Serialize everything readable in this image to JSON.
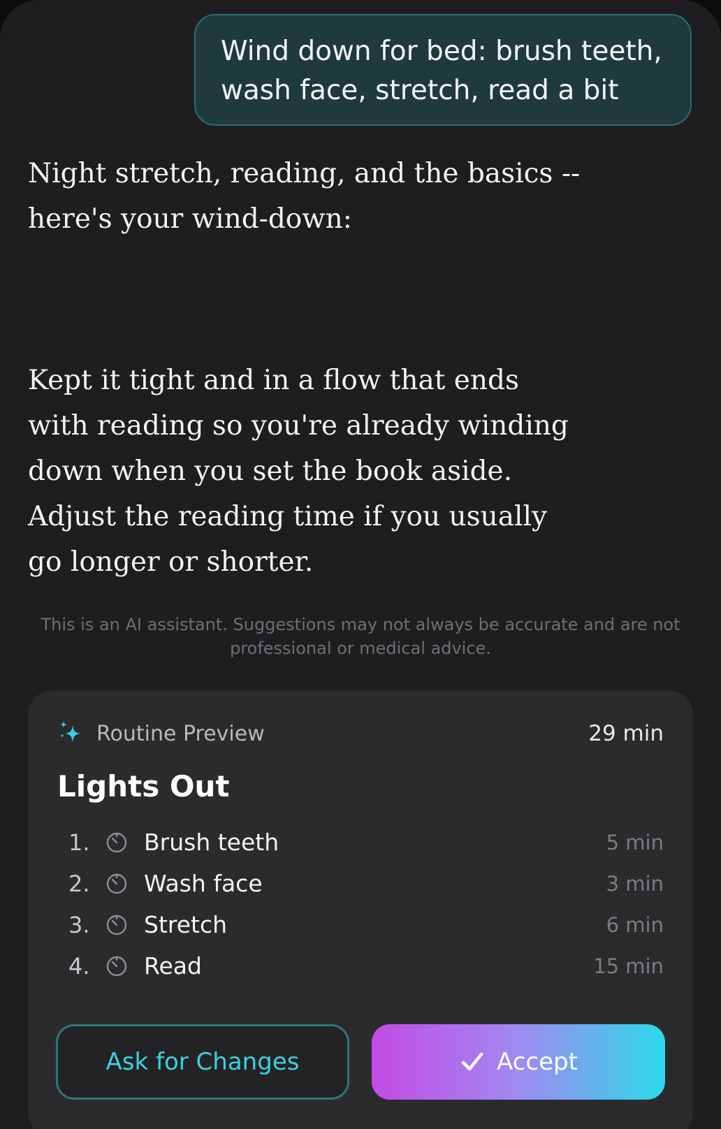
{
  "user_message": {
    "text": "Wind down for bed: brush teeth, wash face, stretch, read a bit"
  },
  "assistant": {
    "intro": "Night stretch, reading, and the basics -- here's your wind-down:",
    "outro": "Kept it tight and in a flow that ends with reading so you're already winding down when you set the book aside. Adjust the reading time if you usually go longer or shorter."
  },
  "disclaimer": "This is an AI assistant. Suggestions may not always be accurate and are not professional or medical advice.",
  "routine_preview": {
    "header_label": "Routine Preview",
    "header_icon": "sparkle-icon",
    "total_duration": "29 min",
    "title": "Lights Out",
    "steps": [
      {
        "number": "1.",
        "icon": "timer-icon",
        "name": "Brush teeth",
        "duration": "5 min"
      },
      {
        "number": "2.",
        "icon": "timer-icon",
        "name": "Wash face",
        "duration": "3 min"
      },
      {
        "number": "3.",
        "icon": "timer-icon",
        "name": "Stretch",
        "duration": "6 min"
      },
      {
        "number": "4.",
        "icon": "timer-icon",
        "name": "Read",
        "duration": "15 min"
      }
    ],
    "ask_changes_label": "Ask for Changes",
    "accept_label": "Accept"
  },
  "colors": {
    "accent_teal": "#3fd0e0",
    "accept_gradient_start": "#c34ae6",
    "accept_gradient_end": "#2bd9ea"
  }
}
